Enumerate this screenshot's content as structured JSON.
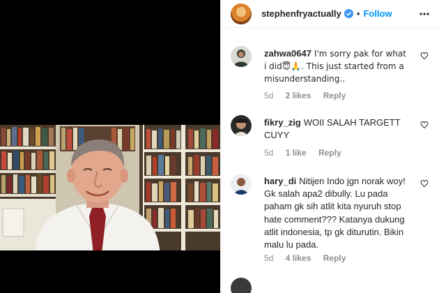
{
  "post": {
    "username": "stephenfryactually",
    "separator": "•",
    "follow_label": "Follow"
  },
  "icons": {
    "verified": "verified-badge-icon",
    "more": "more-options-icon",
    "like": "heart-icon"
  },
  "colors": {
    "accent": "#0095f6",
    "meta_text": "#8e8e8e",
    "text": "#262626"
  },
  "comments": [
    {
      "username": "zahwa0647",
      "text": "I'm sorry pak for what i did😇🙏. This just started from a misunderstanding..",
      "time": "5d",
      "likes": "2 likes",
      "reply": "Reply"
    },
    {
      "username": "fikry_zig",
      "text": "WOII SALAH TARGETT CUYY",
      "time": "5d",
      "likes": "1 like",
      "reply": "Reply"
    },
    {
      "username": "hary_di",
      "text": "Nitijen Indo jgn norak woy! Gk salah apa2 dibully. Lu pada paham gk sih atlit kita nyuruh stop hate comment??? Katanya dukung atlit indonesia, tp gk diturutin. Bikin malu lu pada.",
      "time": "5d",
      "likes": "4 likes",
      "reply": "Reply"
    }
  ]
}
